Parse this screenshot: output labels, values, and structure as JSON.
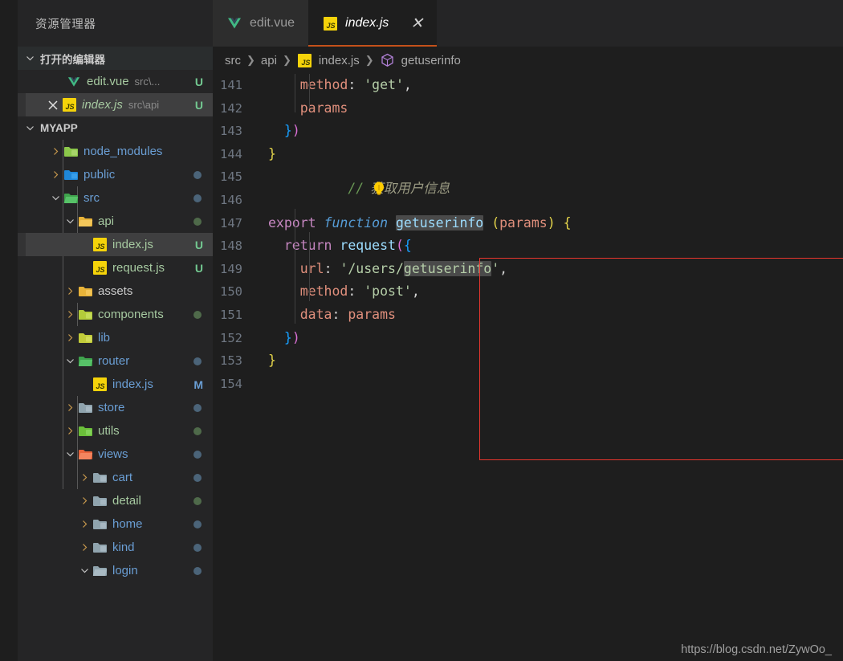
{
  "sidebar": {
    "title": "资源管理器",
    "open_editors": {
      "label": "打开的编辑器",
      "items": [
        {
          "name": "edit.vue",
          "description": "src\\...",
          "badge": "U",
          "icon": "vue-icon",
          "selected": false,
          "closable": false
        },
        {
          "name": "index.js",
          "description": "src\\api",
          "badge": "U",
          "icon": "js-icon",
          "selected": true,
          "closable": true
        }
      ]
    },
    "project": {
      "label": "MYAPP",
      "tree": [
        {
          "name": "node_modules",
          "type": "folder",
          "depth": 1,
          "expanded": false,
          "icon": "folder-node-icon",
          "color": "blue",
          "dot": ""
        },
        {
          "name": "public",
          "type": "folder",
          "depth": 1,
          "expanded": false,
          "icon": "folder-public-icon",
          "color": "blue",
          "dot": "#4b6479"
        },
        {
          "name": "src",
          "type": "folder",
          "depth": 1,
          "expanded": true,
          "icon": "folder-src-icon",
          "color": "blue",
          "dot": "#4b6479"
        },
        {
          "name": "api",
          "type": "folder",
          "depth": 2,
          "expanded": true,
          "icon": "folder-api-icon",
          "color": "green",
          "dot": "#4f6a4a"
        },
        {
          "name": "index.js",
          "type": "file",
          "depth": 3,
          "badge": "U",
          "icon": "js-icon",
          "color": "green",
          "selected": true
        },
        {
          "name": "request.js",
          "type": "file",
          "depth": 3,
          "badge": "U",
          "icon": "js-icon",
          "color": "green"
        },
        {
          "name": "assets",
          "type": "folder",
          "depth": 2,
          "expanded": false,
          "icon": "folder-assets-icon",
          "color": "grey",
          "dot": ""
        },
        {
          "name": "components",
          "type": "folder",
          "depth": 2,
          "expanded": false,
          "icon": "folder-components-icon",
          "color": "green",
          "dot": "#4f6a4a"
        },
        {
          "name": "lib",
          "type": "folder",
          "depth": 2,
          "expanded": false,
          "icon": "folder-lib-icon",
          "color": "blue",
          "dot": ""
        },
        {
          "name": "router",
          "type": "folder",
          "depth": 2,
          "expanded": true,
          "icon": "folder-router-icon",
          "color": "blue",
          "dot": "#4b6479"
        },
        {
          "name": "index.js",
          "type": "file",
          "depth": 3,
          "badge": "M",
          "icon": "js-icon",
          "color": "blue"
        },
        {
          "name": "store",
          "type": "folder",
          "depth": 2,
          "expanded": false,
          "icon": "folder-icon",
          "color": "blue",
          "dot": "#4b6479"
        },
        {
          "name": "utils",
          "type": "folder",
          "depth": 2,
          "expanded": false,
          "icon": "folder-utils-icon",
          "color": "green",
          "dot": "#4f6a4a"
        },
        {
          "name": "views",
          "type": "folder",
          "depth": 2,
          "expanded": true,
          "icon": "folder-views-icon",
          "color": "blue",
          "dot": "#4b6479"
        },
        {
          "name": "cart",
          "type": "folder",
          "depth": 3,
          "expanded": false,
          "icon": "folder-icon",
          "color": "blue",
          "dot": "#4b6479"
        },
        {
          "name": "detail",
          "type": "folder",
          "depth": 3,
          "expanded": false,
          "icon": "folder-icon",
          "color": "green",
          "dot": "#4f6a4a"
        },
        {
          "name": "home",
          "type": "folder",
          "depth": 3,
          "expanded": false,
          "icon": "folder-icon",
          "color": "blue",
          "dot": "#4b6479"
        },
        {
          "name": "kind",
          "type": "folder",
          "depth": 3,
          "expanded": false,
          "icon": "folder-icon",
          "color": "blue",
          "dot": "#4b6479"
        },
        {
          "name": "login",
          "type": "folder",
          "depth": 3,
          "expanded": true,
          "icon": "folder-icon",
          "color": "blue",
          "dot": "#4b6479"
        }
      ]
    }
  },
  "tabs": [
    {
      "label": "edit.vue",
      "icon": "vue-icon",
      "active": false,
      "closable": false
    },
    {
      "label": "index.js",
      "icon": "js-icon",
      "active": true,
      "closable": true,
      "close_glyph": "✕"
    }
  ],
  "breadcrumb": [
    {
      "label": "src",
      "icon": ""
    },
    {
      "label": "api",
      "icon": ""
    },
    {
      "label": "index.js",
      "icon": "js-icon"
    },
    {
      "label": "getuserinfo",
      "icon": "symbol-method-icon"
    }
  ],
  "breadcrumb_separator": "❯",
  "editor": {
    "first_line": 141,
    "lines": [
      {
        "n": 141,
        "text": "    method: 'get',"
      },
      {
        "n": 142,
        "text": "    params"
      },
      {
        "n": 143,
        "text": "  })"
      },
      {
        "n": 144,
        "text": "}"
      },
      {
        "n": 145,
        "text": ""
      },
      {
        "n": 146,
        "text": "// 获取用户信息"
      },
      {
        "n": 147,
        "text": "export function getuserinfo (params) {"
      },
      {
        "n": 148,
        "text": "  return request({"
      },
      {
        "n": 149,
        "text": "    url: '/users/getuserinfo',"
      },
      {
        "n": 150,
        "text": "    method: 'post',"
      },
      {
        "n": 151,
        "text": "    data: params"
      },
      {
        "n": 152,
        "text": "  })"
      },
      {
        "n": 153,
        "text": "}"
      },
      {
        "n": 154,
        "text": ""
      }
    ],
    "comment_text": "获取用户信息",
    "highlighted_symbol": "getuserinfo",
    "lightbulb_icon": "lightbulb-icon",
    "annotation_box_color": "#e8362e"
  },
  "watermark": "https://blog.csdn.net/ZywOo_",
  "colors": {
    "accent_tab_border": "#c4511a",
    "sidebar_bg": "#252526",
    "editor_bg": "#1e1e1e",
    "selection": "#3f3f40",
    "untracked_green": "#73c991",
    "modified_blue": "#6a9ed4"
  }
}
